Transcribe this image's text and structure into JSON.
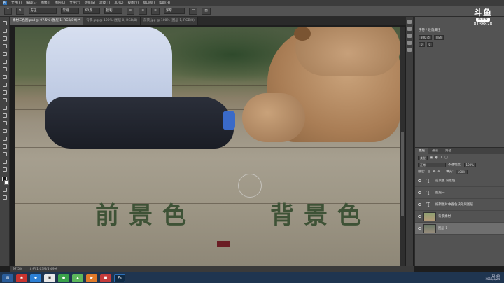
{
  "menubar": {
    "app_logo": "Ps",
    "items": [
      "文件(F)",
      "编辑(E)",
      "图像(I)",
      "图层(L)",
      "文字(Y)",
      "选择(S)",
      "滤镜(T)",
      "3D(D)",
      "视图(V)",
      "窗口(W)",
      "帮助(H)"
    ]
  },
  "options": {
    "font_family": "方正",
    "font_style": "常规",
    "font_size": "60点",
    "antialias": "锐利",
    "color_label": "浑厚"
  },
  "tabs": [
    {
      "label": "素材三色图.psd @ 97.5% (图层 1, RGB/8#) *",
      "active": true
    },
    {
      "label": "背景.jpg @ 100% (图层 0, RGB/8)",
      "active": false
    },
    {
      "label": "前景.jpg @ 100% (图层 1, RGB/8)",
      "active": false
    }
  ],
  "canvas": {
    "caption_foreground": "前景色",
    "caption_background": "背景色"
  },
  "status": {
    "zoom": "97.5%",
    "doc": "文档:1.03M/5.49M"
  },
  "watermark": {
    "logo": "斗鱼",
    "badge": "房间号",
    "room_id": "8138828"
  },
  "properties": {
    "title": "字符 / 段落属性",
    "row1": [
      "200 点",
      "自动"
    ],
    "row2": [
      "0",
      "0"
    ]
  },
  "layers": {
    "tabs": [
      "图层",
      "通道",
      "路径"
    ],
    "kind": "类型",
    "blend": "正常",
    "opacity_label": "不透明度:",
    "opacity": "100%",
    "lock_label": "锁定:",
    "fill_label": "填充:",
    "fill": "100%",
    "rows": [
      {
        "type": "text",
        "name": "前景色 背景色",
        "selected": false
      },
      {
        "type": "text",
        "name": "图层一",
        "selected": false
      },
      {
        "type": "text",
        "name": "编辑图片中各色块效果图层",
        "selected": false
      },
      {
        "type": "image",
        "name": "背景素材",
        "selected": false
      },
      {
        "type": "image",
        "name": "图层 1",
        "selected": true
      }
    ]
  },
  "taskbar": {
    "time": "12:43",
    "date": "2016/3/24"
  }
}
